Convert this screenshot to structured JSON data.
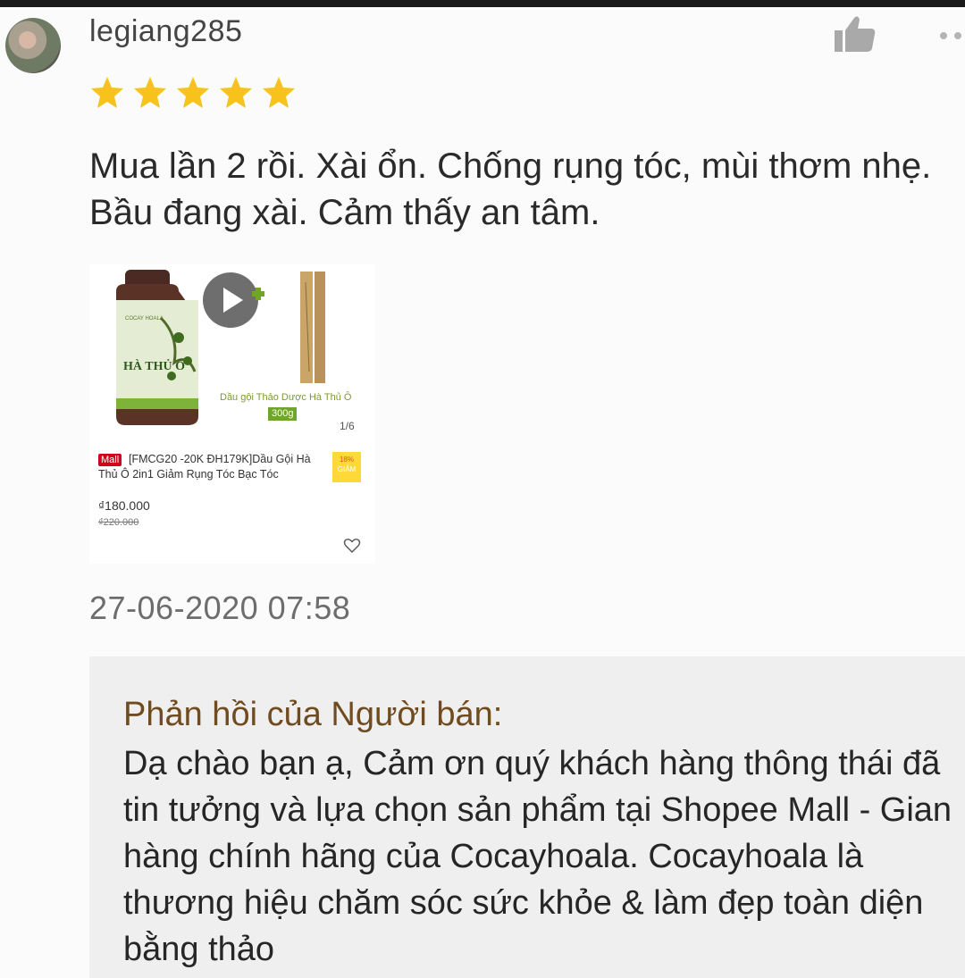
{
  "review": {
    "username": "legiang285",
    "rating": 5,
    "text": "Mua lần 2 rồi. Xài ổn. Chống rụng tóc, mùi thơm nhẹ. Bầu đang xài. Cảm thấy an tâm.",
    "timestamp": "27-06-2020 07:58"
  },
  "icons": {
    "avatar": "avatar",
    "like": "thumbs-up-icon",
    "more": "more-dots-icon",
    "star": "star-icon",
    "play": "play-icon",
    "heart": "heart-icon"
  },
  "product": {
    "mall_badge": "Mall",
    "title": "[FMCG20 -20K ĐH179K]Dầu Gội Hà Thủ Ô 2in1 Giảm Rụng Tóc Bạc Tóc",
    "discount": "18%",
    "discount_label": "GIẢM",
    "price": "₫180.000",
    "old_price": "₫220.000",
    "image_counter": "1/6",
    "image_caption": "Dầu gội Thảo Dược Hà Thủ Ô",
    "weight": "300g",
    "bottle_label": "HÀ THỦ Ô",
    "brand_label": "COCAY HOALA"
  },
  "seller": {
    "heading": "Phản hồi của Người bán:",
    "text": "Dạ chào bạn ạ, Cảm ơn quý khách hàng thông thái đã tin tưởng và lựa chọn sản phẩm tại Shopee Mall - Gian hàng chính hãng của Cocayhoala. Cocayhoala là thương hiệu chăm sóc sức khỏe & làm đẹp toàn diện bằng thảo"
  },
  "colors": {
    "star": "#f7c21c",
    "seller_heading": "#6f4b1f",
    "mall_red": "#d0011b",
    "accent_orange": "#ee4d2d"
  }
}
